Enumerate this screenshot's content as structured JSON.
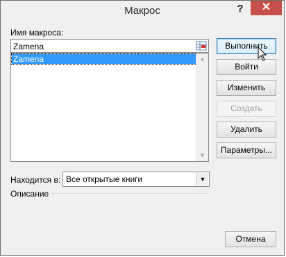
{
  "window": {
    "title": "Макрос",
    "help": "?",
    "close": "✕"
  },
  "macro_name_label": "Имя макроса:",
  "macro_name_value": "Zamena",
  "macros": [
    "Zamena"
  ],
  "buttons": {
    "run": "Выполнить",
    "step_into": "Войти",
    "edit": "Изменить",
    "create": "Создать",
    "delete": "Удалить",
    "options": "Параметры...",
    "cancel": "Отмена"
  },
  "location_label": "Находится в:",
  "location_value": "Все открытые книги",
  "description_label": "Описание"
}
